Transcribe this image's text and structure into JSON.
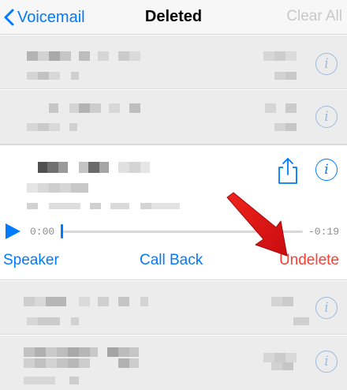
{
  "nav": {
    "back_label": "Voicemail",
    "title": "Deleted",
    "right_label": "Clear All"
  },
  "player": {
    "elapsed": "0:00",
    "remaining": "-0:19",
    "progress": 0
  },
  "actions": {
    "speaker": "Speaker",
    "call_back": "Call Back",
    "undelete": "Undelete"
  },
  "colors": {
    "accent": "#007aff",
    "destructive": "#ff3b30",
    "annotation_arrow": "#e3111a"
  },
  "icons": {
    "back": "chevron-left-icon",
    "info": "info-circle-icon",
    "share": "share-icon",
    "play": "play-icon"
  }
}
